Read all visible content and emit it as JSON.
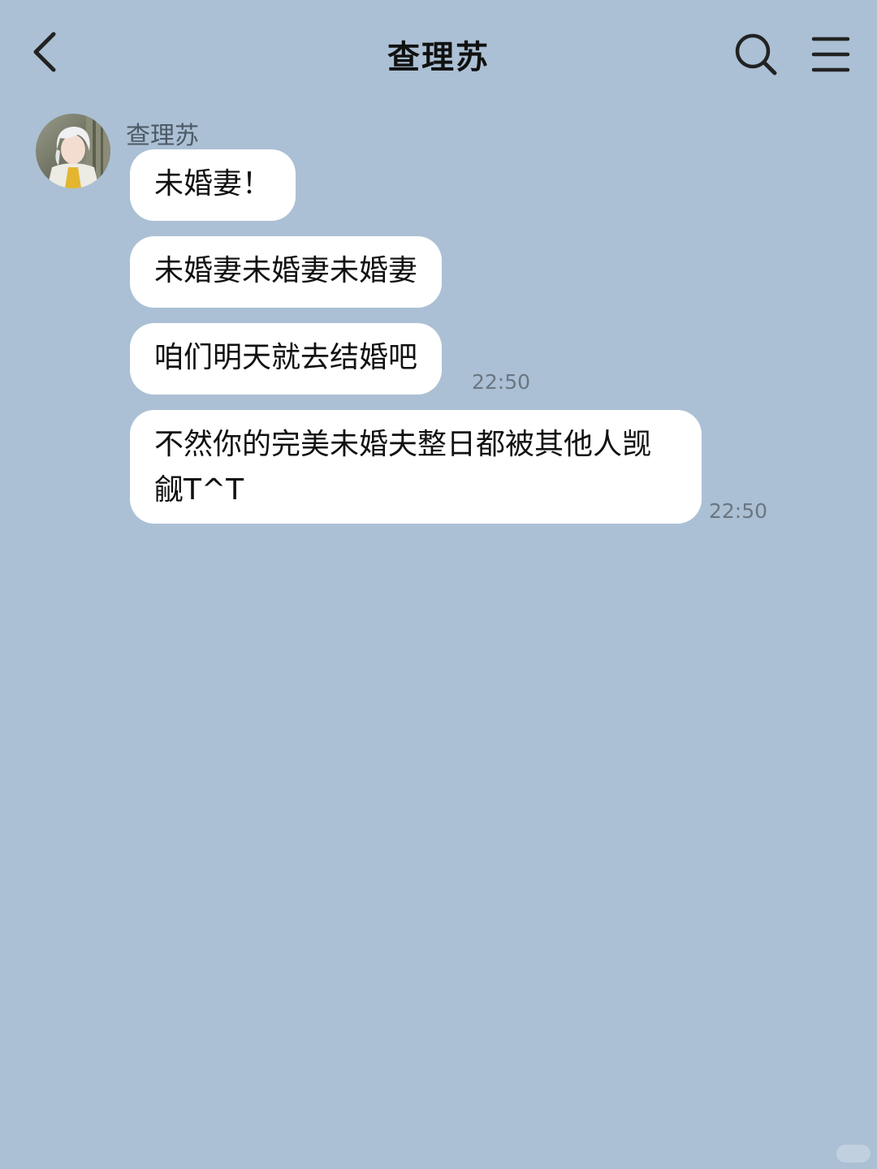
{
  "header": {
    "title": "查理苏",
    "back_icon": "chevron-left-icon",
    "search_icon": "search-icon",
    "menu_icon": "menu-icon"
  },
  "chat": {
    "sender_name": "查理苏",
    "avatar_icon": "avatar",
    "messages": [
      {
        "text": "未婚妻！",
        "time": ""
      },
      {
        "text": "未婚妻未婚妻未婚妻",
        "time": ""
      },
      {
        "text": "咱们明天就去结婚吧",
        "time": "22:50"
      },
      {
        "text": "不然你的完美未婚夫整日都被其他人觊觎T^T",
        "time": "22:50"
      }
    ]
  },
  "colors": {
    "background": "#abc0d4",
    "bubble": "#ffffff",
    "text": "#111111",
    "timestamp": "#6b7682"
  }
}
